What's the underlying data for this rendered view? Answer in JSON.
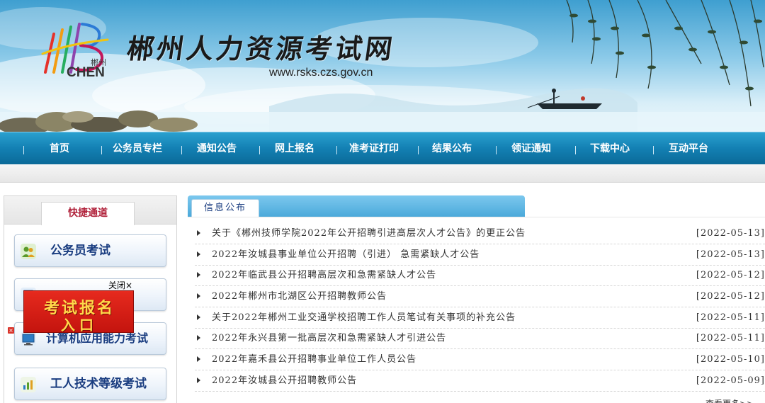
{
  "banner": {
    "title": "郴州人力资源考试网",
    "url": "www.rsks.czs.gov.cn",
    "logo_text": "CHEN",
    "logo_cn": "郴州"
  },
  "nav": {
    "items": [
      {
        "label": "首页"
      },
      {
        "label": "公务员专栏"
      },
      {
        "label": "通知公告"
      },
      {
        "label": "网上报名"
      },
      {
        "label": "准考证打印"
      },
      {
        "label": "结果公布"
      },
      {
        "label": "领证通知"
      },
      {
        "label": "下载中心"
      },
      {
        "label": "互动平台"
      }
    ]
  },
  "sidebar": {
    "title": "快捷通道",
    "items": [
      {
        "label": "公务员考试",
        "icon": "people-icon"
      },
      {
        "label": "",
        "icon": "document-icon"
      },
      {
        "label": "计算机应用能力考试",
        "icon": "computer-icon"
      },
      {
        "label": "工人技术等级考试",
        "icon": "chart-icon"
      }
    ]
  },
  "popup": {
    "close_label": "关闭×",
    "ad_line1": "考试报名",
    "ad_line2": "入口",
    "accent": "#d81e14"
  },
  "content": {
    "tab_label": "信息公布",
    "more_label": "查看更多>>",
    "news": [
      {
        "title": "关于《郴州技师学院2022年公开招聘引进高层次人才公告》的更正公告",
        "date": "[2022-05-13]"
      },
      {
        "title": "2022年汝城县事业单位公开招聘（引进） 急需紧缺人才公告",
        "date": "[2022-05-13]"
      },
      {
        "title": "2022年临武县公开招聘高层次和急需紧缺人才公告",
        "date": "[2022-05-12]"
      },
      {
        "title": "2022年郴州市北湖区公开招聘教师公告",
        "date": "[2022-05-12]"
      },
      {
        "title": "关于2022年郴州工业交通学校招聘工作人员笔试有关事项的补充公告",
        "date": "[2022-05-11]"
      },
      {
        "title": "2022年永兴县第一批高层次和急需紧缺人才引进公告",
        "date": "[2022-05-11]"
      },
      {
        "title": "2022年嘉禾县公开招聘事业单位工作人员公告",
        "date": "[2022-05-10]"
      },
      {
        "title": "2022年汝城县公开招聘教师公告",
        "date": "[2022-05-09]"
      }
    ]
  },
  "colors": {
    "nav_blue": "#1380b3",
    "link_blue": "#1a3d80",
    "tab_red": "#b0213a"
  }
}
